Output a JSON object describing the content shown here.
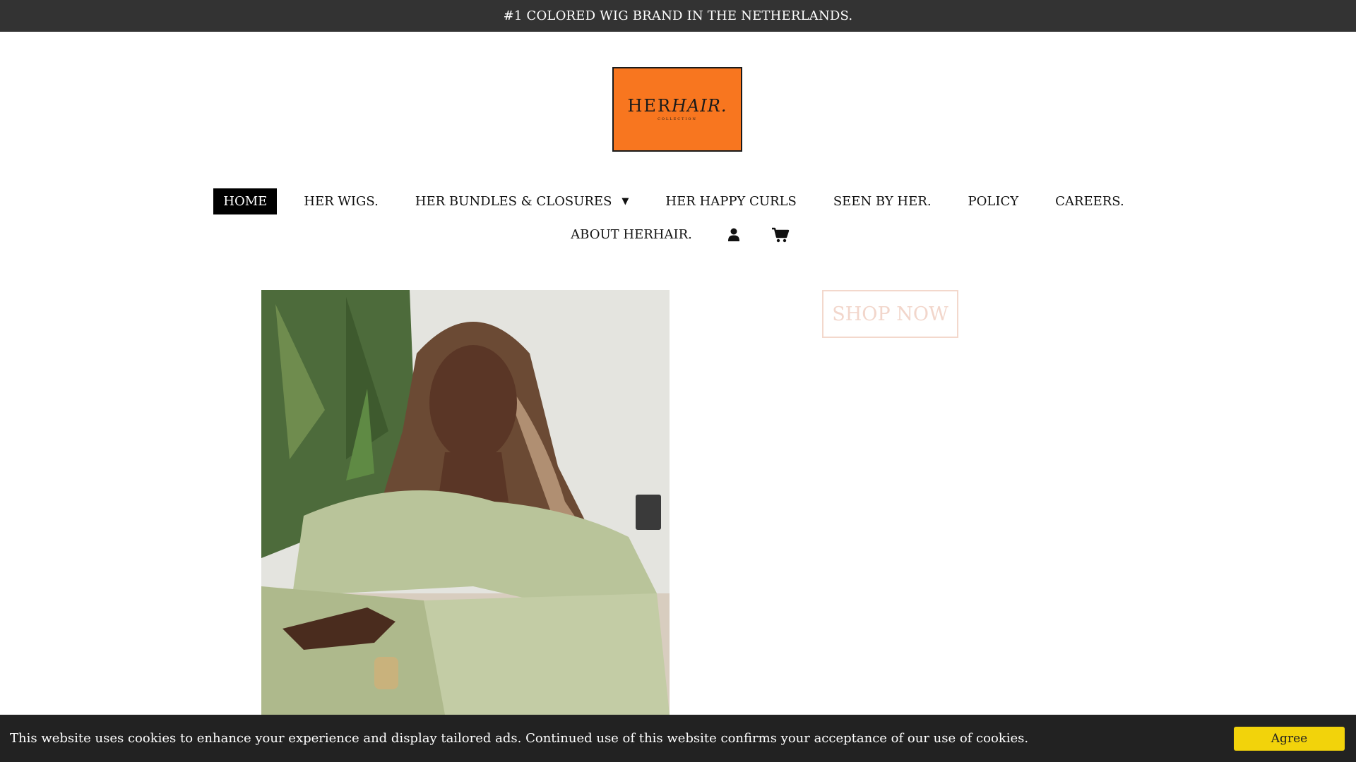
{
  "announcement": {
    "text": "#1 COLORED WIG BRAND IN THE NETHERLANDS."
  },
  "logo": {
    "her": "HER",
    "hair": "HAIR.",
    "sub": "COLLECTION",
    "bg_color": "#F8761F"
  },
  "nav": {
    "row1": [
      {
        "label": "HOME",
        "active": true
      },
      {
        "label": "HER WIGS."
      },
      {
        "label": "HER BUNDLES & CLOSURES",
        "caret": "▼"
      },
      {
        "label": "HER HAPPY CURLS"
      },
      {
        "label": "SEEN BY HER."
      },
      {
        "label": "POLICY"
      },
      {
        "label": "CAREERS."
      }
    ],
    "row2": [
      {
        "label": "ABOUT HERHAIR."
      }
    ],
    "account_icon": "user-icon",
    "cart_icon": "cart-icon"
  },
  "hero": {
    "shop_now_label": "SHOP NOW",
    "image_alt": "model-photo"
  },
  "cookie": {
    "text": "This website uses cookies to enhance your experience and display tailored ads. Continued use of this website confirms your acceptance of our use of cookies.",
    "agree_label": "Agree",
    "agree_color": "#F2D30B"
  },
  "colors": {
    "announce_bg": "#333333",
    "cookie_bg": "#222222",
    "shop_border": "#f3d8cc"
  }
}
